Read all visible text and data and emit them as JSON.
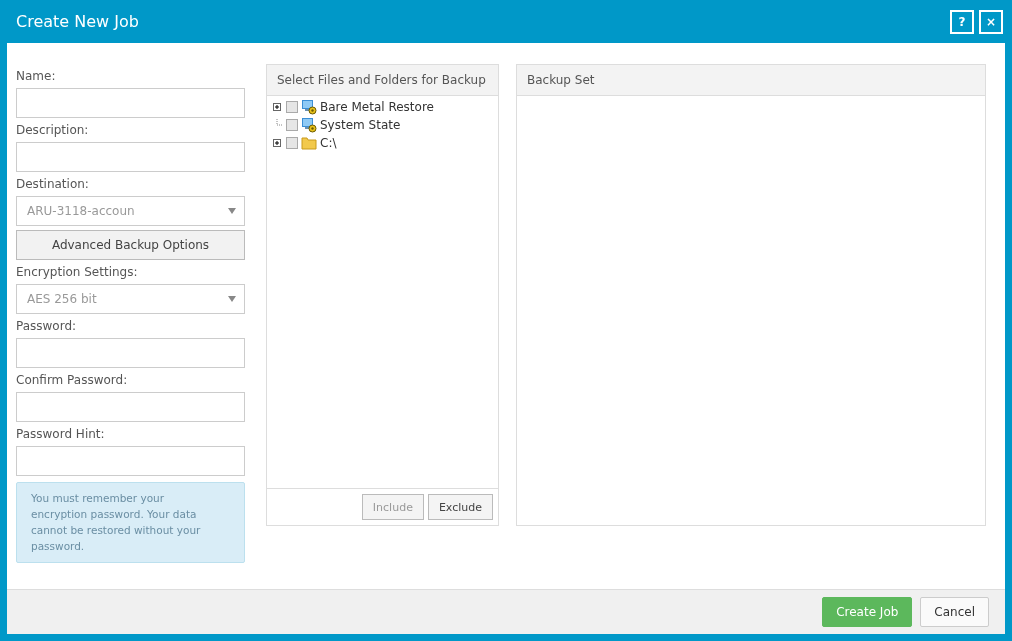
{
  "window": {
    "title": "Create New Job",
    "buttons": [
      "?",
      "×"
    ]
  },
  "form": {
    "fields": [
      {
        "kind": "text",
        "label": "Name:"
      },
      {
        "kind": "text",
        "label": "Description:"
      },
      {
        "kind": "select",
        "label": "Destination:",
        "value": "ARU-3118-accoun"
      },
      {
        "kind": "button",
        "label": "Advanced Backup Options"
      },
      {
        "kind": "select",
        "label": "Encryption Settings:",
        "value": "AES 256 bit"
      },
      {
        "kind": "text",
        "label": "Password:"
      },
      {
        "kind": "text",
        "label": "Confirm Password:"
      },
      {
        "kind": "text",
        "label": "Password Hint:"
      }
    ],
    "notice": "You must remember your encryption password. Your data cannot be restored without your password."
  },
  "file_panel": {
    "title": "Select Files and Folders for Backup",
    "tree": [
      {
        "label": "Bare Metal Restore",
        "kind": "system",
        "expandable": true,
        "checked": false
      },
      {
        "label": "System State",
        "kind": "system",
        "expandable": false,
        "checked": false
      },
      {
        "label": "C:\\",
        "kind": "folder",
        "expandable": true,
        "checked": false
      }
    ],
    "buttons": [
      {
        "label": "Include",
        "disabled": true
      },
      {
        "label": "Exclude",
        "disabled": false
      }
    ]
  },
  "backup_set": {
    "title": "Backup Set"
  },
  "footer": {
    "buttons": [
      {
        "label": "Create Job",
        "kind": "primary"
      },
      {
        "label": "Cancel",
        "kind": "default"
      }
    ]
  }
}
